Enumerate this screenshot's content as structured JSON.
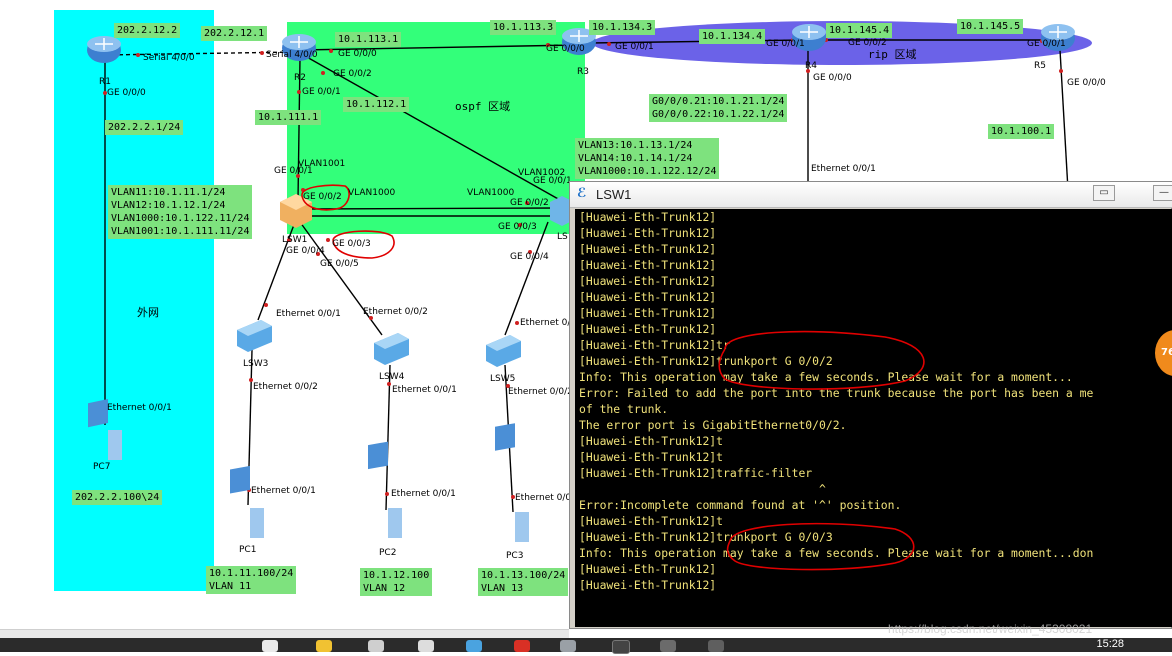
{
  "colors": {
    "outside_area": "#00ffff",
    "ospf_area": "#33ff7a",
    "rip_area": "#6b62e8",
    "label_bg": "#7ee27e",
    "link": "#000000",
    "console_bg": "#000000",
    "console_text": "#f0e27a",
    "highlight": "#e00000"
  },
  "areas": {
    "outside": "外网",
    "ospf": "ospf 区域",
    "rip": "rip 区域"
  },
  "devices": {
    "r1": "R1",
    "r2": "R2",
    "r3": "R3",
    "r4": "R4",
    "r5": "R5",
    "lsw1": "LSW1",
    "lsw2": "LS",
    "lsw3": "LSW3",
    "lsw4": "LSW4",
    "lsw5": "LSW5",
    "pc1": "PC1",
    "pc2": "PC2",
    "pc3": "PC3",
    "pc7": "PC7"
  },
  "labels": {
    "r1_ip": "202.2.12.2",
    "r2_serial_ip": "202.2.12.1",
    "r2_113": "10.1.113.1",
    "r3_113": "10.1.113.3",
    "r3_134": "10.1.134.3",
    "r4_134": "10.1.134.4",
    "r4_145": "10.1.145.4",
    "r5_145": "10.1.145.5",
    "r2_111": "10.1.111.1",
    "r2_112": "10.1.112.1",
    "r1_out": "202.2.2.1/24",
    "pc7_ip": "202.2.2.100\\24",
    "r5_100": "10.1.100.1",
    "lsw1_vlans": "VLAN11:10.1.11.1/24\nVLAN12:10.1.12.1/24\nVLAN1000:10.1.122.11/24\nVLAN1001:10.1.111.11/24",
    "r4_subifs": "G0/0/0.21:10.1.21.1/24\nG0/0/0.22:10.1.22.1/24",
    "lsw2_vlans": "VLAN13:10.1.13.1/24\nVLAN14:10.1.14.1/24\nVLAN1000:10.1.122.12/24",
    "pc1_ip": "10.1.11.100/24\nVLAN 11",
    "pc2_ip": "10.1.12.100\nVLAN 12",
    "pc3_ip": "10.1.13.100/24\nVLAN 13"
  },
  "ports": {
    "r1_serial": "Serial 4/0/0",
    "r1_ge": "GE 0/0/0",
    "r2_serial": "Serial 4/0/0",
    "r2_g000": "GE 0/0/0",
    "r2_g002": "GE 0/0/2",
    "r2_g001": "GE 0/0/1",
    "r3_g000": "GE 0/0/0",
    "r3_g001": "GE 0/0/1",
    "r4_g001": "GE 0/0/1",
    "r4_g002": "GE 0/0/2",
    "r4_g000": "GE 0/0/0",
    "r5_g001": "GE 0/0/1",
    "r5_g000": "GE 0/0/0",
    "lsw1_g001": "GE 0/0/1",
    "lsw1_g002": "GE 0/0/2",
    "lsw1_g003": "GE 0/0/3",
    "lsw1_g004": "GE 0/0/4",
    "lsw1_g005": "GE 0/0/5",
    "vlan1001": "VLAN1001",
    "vlan1000_a": "VLAN1000",
    "vlan1000_b": "VLAN1000",
    "vlan1002": "VLAN1002",
    "lsw2_g001": "GE 0/0/1",
    "lsw2_g002": "GE 0/0/2",
    "lsw2_g003": "GE 0/0/3",
    "lsw2_g004": "GE 0/0/4",
    "r4_eth": "Ethernet 0/0/1",
    "lsw3_up": "Ethernet 0/0/1",
    "lsw3_dn": "Ethernet 0/0/2",
    "lsw4_up": "Ethernet 0/0/2",
    "lsw4_dn": "Ethernet 0/0/1",
    "lsw5_up": "Ethernet 0/0/1",
    "lsw5_dn": "Ethernet 0/0/2",
    "pc1_eth": "Ethernet 0/0/1",
    "pc2_eth": "Ethernet 0/0/1",
    "pc3_eth": "Ethernet 0/0/1",
    "pc7_eth": "Ethernet 0/0/1"
  },
  "window": {
    "title": "LSW1"
  },
  "console_lines": [
    "[Huawei-Eth-Trunk12]",
    "[Huawei-Eth-Trunk12]",
    "[Huawei-Eth-Trunk12]",
    "[Huawei-Eth-Trunk12]",
    "[Huawei-Eth-Trunk12]",
    "[Huawei-Eth-Trunk12]",
    "[Huawei-Eth-Trunk12]",
    "[Huawei-Eth-Trunk12]",
    "[Huawei-Eth-Trunk12]tr",
    "[Huawei-Eth-Trunk12]trunkport G 0/0/2",
    "Info: This operation may take a few seconds. Please wait for a moment...",
    "Error: Failed to add the port into the trunk because the port has been a me",
    "of the trunk.",
    "The error port is GigabitEthernet0/0/2.",
    "[Huawei-Eth-Trunk12]t",
    "[Huawei-Eth-Trunk12]t",
    "[Huawei-Eth-Trunk12]traffic-filter",
    "                                   ^",
    "Error:Incomplete command found at '^' position.",
    "[Huawei-Eth-Trunk12]t",
    "[Huawei-Eth-Trunk12]trunkport G 0/0/3",
    "Info: This operation may take a few seconds. Please wait for a moment...don",
    "[Huawei-Eth-Trunk12]",
    "[Huawei-Eth-Trunk12]"
  ],
  "taskbar": {
    "time": "15:28"
  },
  "watermark": "https://blog.csdn.net/weixin_45308021",
  "badge": "76"
}
